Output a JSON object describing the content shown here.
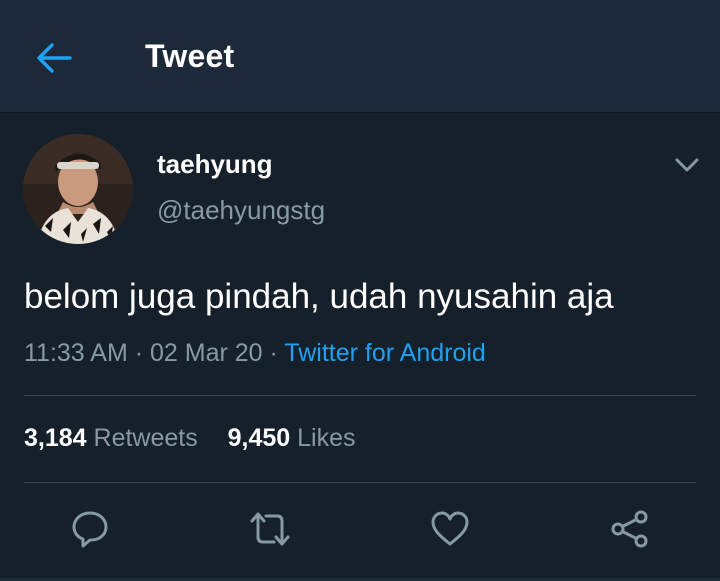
{
  "header": {
    "title": "Tweet",
    "back_icon": "arrow-left-icon"
  },
  "tweet": {
    "author": {
      "display_name": "taehyung",
      "handle": "@taehyungstg",
      "avatar": "profile-photo"
    },
    "text": "belom juga pindah, udah nyusahin aja",
    "time": "11:33 AM",
    "date": "02 Mar 20",
    "separator": "·",
    "source": "Twitter for Android",
    "stats": {
      "retweets_count": "3,184",
      "retweets_label": "Retweets",
      "likes_count": "9,450",
      "likes_label": "Likes"
    },
    "actions": [
      "reply-icon",
      "retweet-icon",
      "like-icon",
      "share-icon"
    ]
  },
  "colors": {
    "background": "#15202b",
    "header_bg": "#1c2938",
    "accent": "#1da1f2",
    "secondary_text": "#8899a6",
    "divider": "#38444d"
  }
}
